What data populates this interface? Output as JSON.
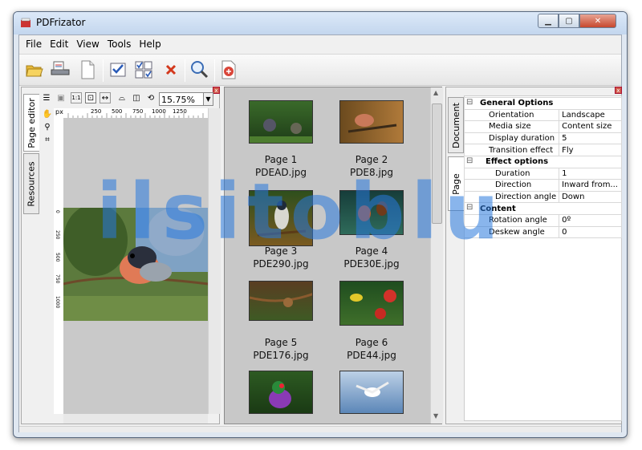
{
  "window": {
    "title": "PDFrizator"
  },
  "menu": [
    "File",
    "Edit",
    "View",
    "Tools",
    "Help"
  ],
  "toolbar": {
    "buttons": [
      "open-folder-icon",
      "scanner-icon",
      "blank-page-icon",
      "checklist-icon",
      "grid-check-icon",
      "delete-icon",
      "zoom-search-icon",
      "export-pdf-icon"
    ]
  },
  "left_panel": {
    "tabs": [
      "Page editor",
      "Resources"
    ],
    "zoom": "15.75%",
    "ruler_unit": "px",
    "h_ruler_ticks": [
      "250",
      "500",
      "750",
      "1000",
      "1250"
    ],
    "v_ruler_ticks": [
      "0",
      "250",
      "500",
      "750",
      "1000"
    ]
  },
  "thumbnails": [
    {
      "page": "Page 1",
      "file": "PDEAD.jpg"
    },
    {
      "page": "Page 2",
      "file": "PDE8.jpg"
    },
    {
      "page": "Page 3",
      "file": "PDE290.jpg"
    },
    {
      "page": "Page 4",
      "file": "PDE30E.jpg"
    },
    {
      "page": "Page 5",
      "file": "PDE176.jpg"
    },
    {
      "page": "Page 6",
      "file": "PDE44.jpg"
    }
  ],
  "right_panel": {
    "tabs": [
      "Document",
      "Page"
    ],
    "properties": [
      {
        "type": "category",
        "label": "General Options",
        "indent": 0
      },
      {
        "type": "prop",
        "label": "Orientation",
        "value": "Landscape"
      },
      {
        "type": "prop",
        "label": "Media size",
        "value": "Content size"
      },
      {
        "type": "prop",
        "label": "Display duration",
        "value": "5"
      },
      {
        "type": "prop",
        "label": "Transition effect",
        "value": "Fly"
      },
      {
        "type": "category",
        "label": "Effect options",
        "indent": 1
      },
      {
        "type": "prop2",
        "label": "Duration",
        "value": "1"
      },
      {
        "type": "prop2",
        "label": "Direction",
        "value": "Inward from..."
      },
      {
        "type": "prop2",
        "label": "Direction angle",
        "value": "Down"
      },
      {
        "type": "category",
        "label": "Content",
        "indent": 0
      },
      {
        "type": "prop",
        "label": "Rotation angle",
        "value": "0º"
      },
      {
        "type": "prop",
        "label": "Deskew angle",
        "value": "0"
      }
    ]
  },
  "watermark": "ilsitoblu"
}
